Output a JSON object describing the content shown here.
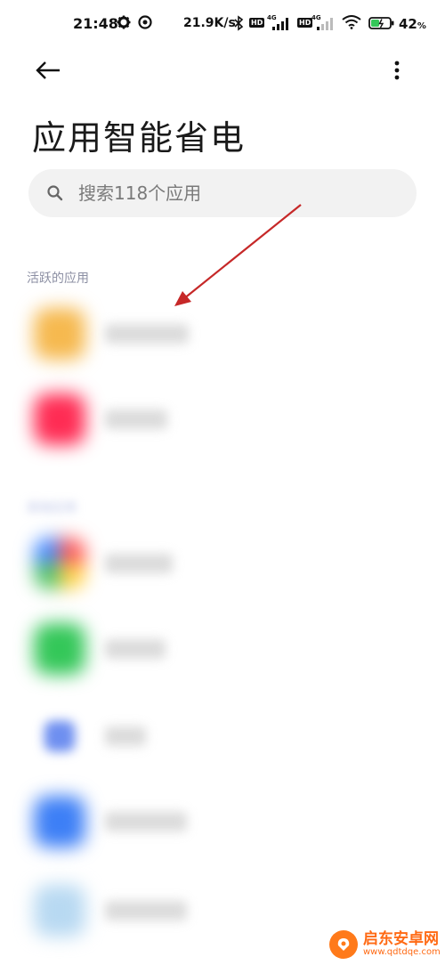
{
  "status_bar": {
    "time": "21:48",
    "net_speed": "21.9K/s",
    "hd": "HD",
    "net_type": "4G",
    "battery_pct": "42",
    "battery_unit": "%"
  },
  "header": {
    "title": "应用智能省电"
  },
  "search": {
    "placeholder": "搜索118个应用"
  },
  "sections": {
    "active_label": "活跃的应用",
    "other_label": "其他应用"
  },
  "apps": [
    {
      "name": "百度网盘",
      "icon_color": "#f6b94f"
    },
    {
      "name": "小红书",
      "icon_color": "#ff2c54"
    },
    {
      "name": "应用商店",
      "icon_color": "#55c56a"
    },
    {
      "name": "微信支付",
      "icon_color": "#34c759"
    },
    {
      "name": "钉钉",
      "icon_color": "#6e8ff0"
    },
    {
      "name": "文件管理",
      "icon_color": "#3d7ff6"
    },
    {
      "name": "天气预报",
      "icon_color": "#b8d9f2"
    }
  ],
  "watermark": {
    "name": "启东安卓网",
    "url": "www.qdtdqe.com"
  },
  "annotation_color": "#c62828"
}
